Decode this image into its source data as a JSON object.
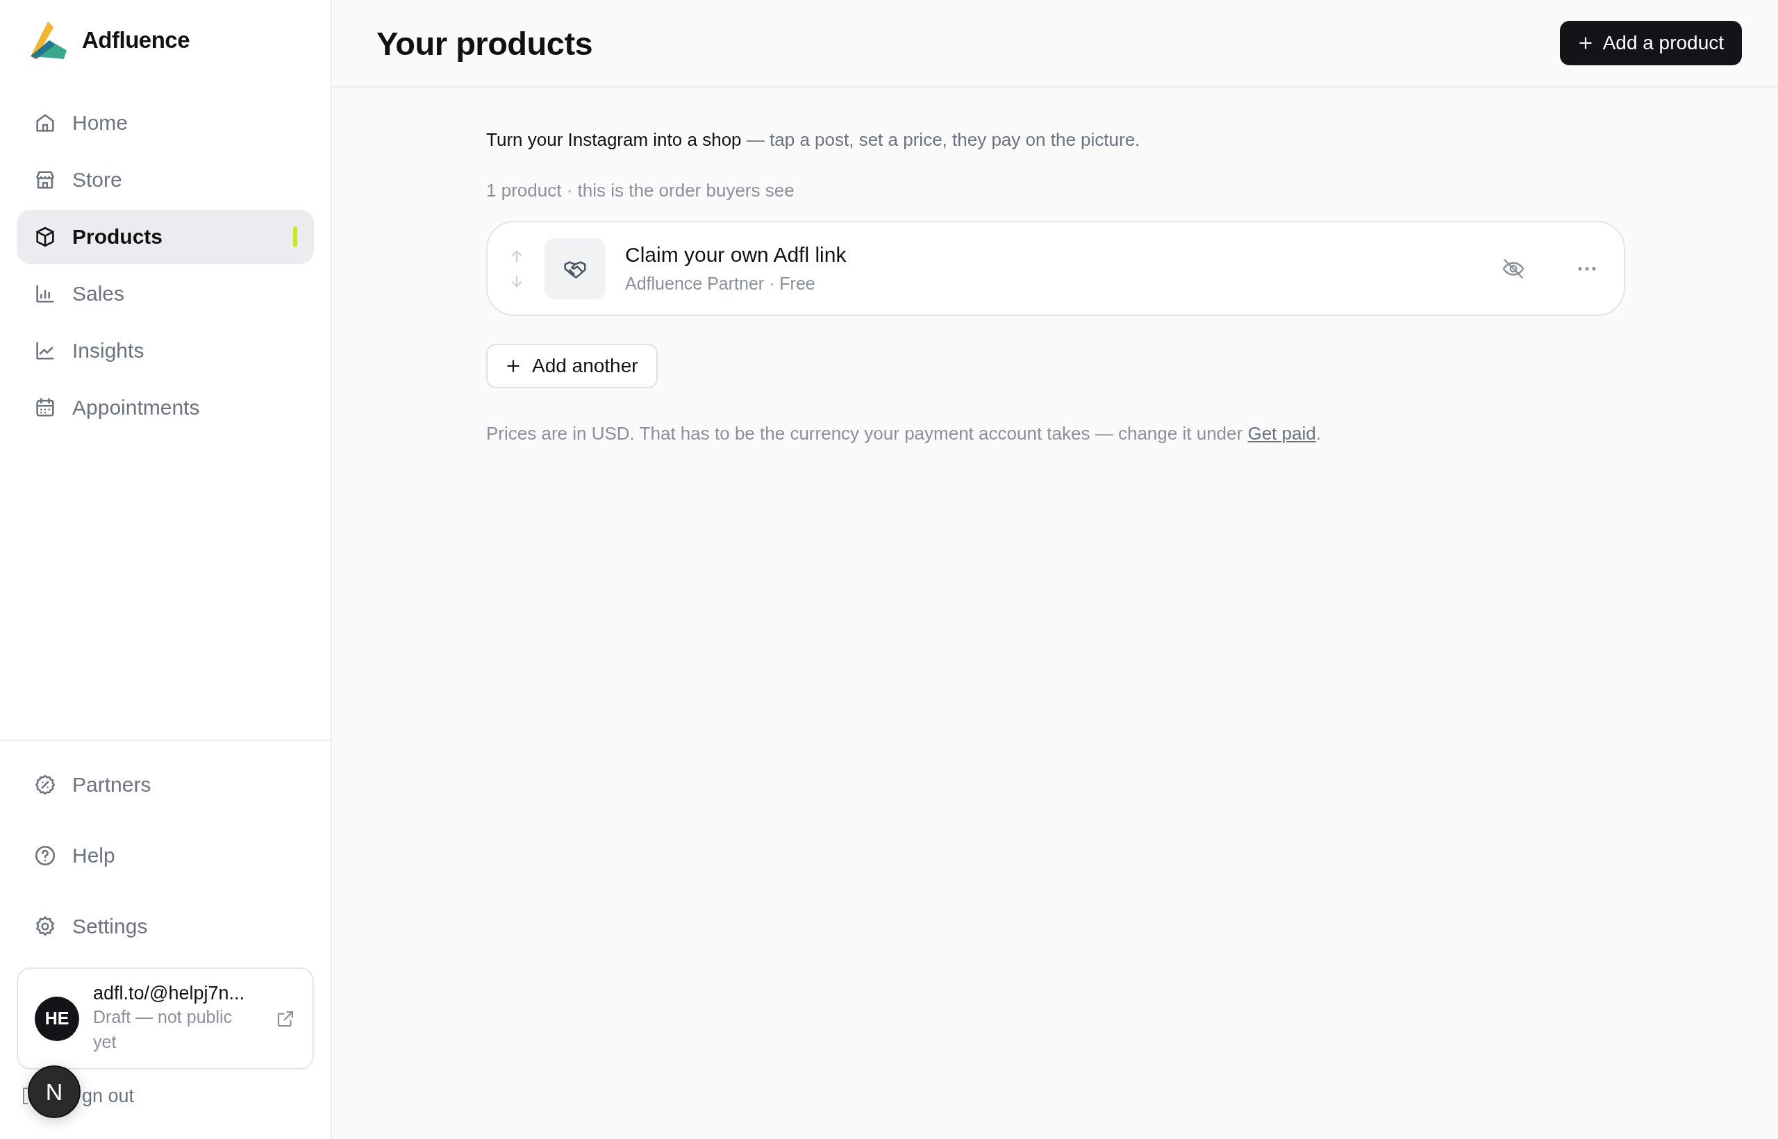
{
  "sidebar": {
    "brand": "Adfluence",
    "items": [
      {
        "label": "Home",
        "selected": false
      },
      {
        "label": "Store",
        "selected": false
      },
      {
        "label": "Products",
        "selected": true
      },
      {
        "label": "Sales",
        "selected": false
      },
      {
        "label": "Insights",
        "selected": false
      },
      {
        "label": "Appointments",
        "selected": false
      }
    ],
    "footer_items": [
      {
        "label": "Partners",
        "selected": false
      },
      {
        "label": "Help",
        "selected": false
      },
      {
        "label": "Settings",
        "selected": false
      }
    ],
    "profile": {
      "initials": "HE",
      "link": "adfl.to/@helpj7n...",
      "status": "Draft — not public yet"
    },
    "sign_out": "gn out",
    "dev_badge": "N"
  },
  "header": {
    "title": "Your products",
    "button": "Add a product"
  },
  "intro": "**Turn your Instagram into a shop** — tap a post, set a price, they pay on the picture.",
  "count_line": "1 product · this is the order buyers see",
  "products": [
    {
      "name": "Claim your own Adfl link",
      "meta": "Adfluence Partner · Free"
    }
  ],
  "add_another": "Add another",
  "footnote": {
    "text": "Prices are in USD. That has to be the currency your payment account takes — change it under",
    "link": "Get paid",
    "end": "."
  }
}
